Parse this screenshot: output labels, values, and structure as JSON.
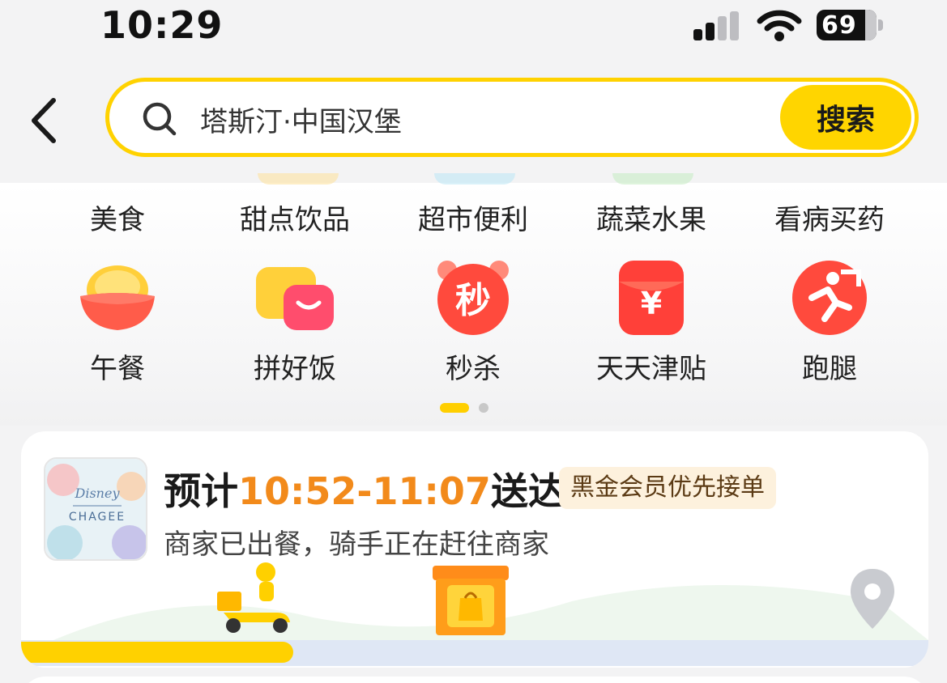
{
  "status_bar": {
    "time": "10:29",
    "battery": "69"
  },
  "search": {
    "query": "塔斯汀·中国汉堡",
    "button_label": "搜索"
  },
  "categories_row1": [
    "美食",
    "甜点饮品",
    "超市便利",
    "蔬菜水果",
    "看病买药"
  ],
  "categories_row2": [
    {
      "label": "午餐",
      "icon": "rice-bowl-icon"
    },
    {
      "label": "拼好饭",
      "icon": "group-meal-icon"
    },
    {
      "label": "秒杀",
      "icon": "flash-sale-clock-icon",
      "icon_text": "秒"
    },
    {
      "label": "天天津贴",
      "icon": "red-envelope-yuan-icon",
      "icon_text": "¥"
    },
    {
      "label": "跑腿",
      "icon": "errand-runner-icon"
    }
  ],
  "order": {
    "store_logo_text": "CHAGEE",
    "store_logo_brand": "Disney",
    "eta_prefix": "预计",
    "eta_time": "10:52-11:07",
    "eta_suffix": "送达",
    "vip_badge": "黑金会员优先接单",
    "status": "商家已出餐，骑手正在赶往商家",
    "progress": 0.3
  },
  "colors": {
    "accent_yellow": "#ffd500",
    "eta_orange": "#f28a1b",
    "card_bg": "#ffffff",
    "page_bg": "#f3f3f4"
  }
}
